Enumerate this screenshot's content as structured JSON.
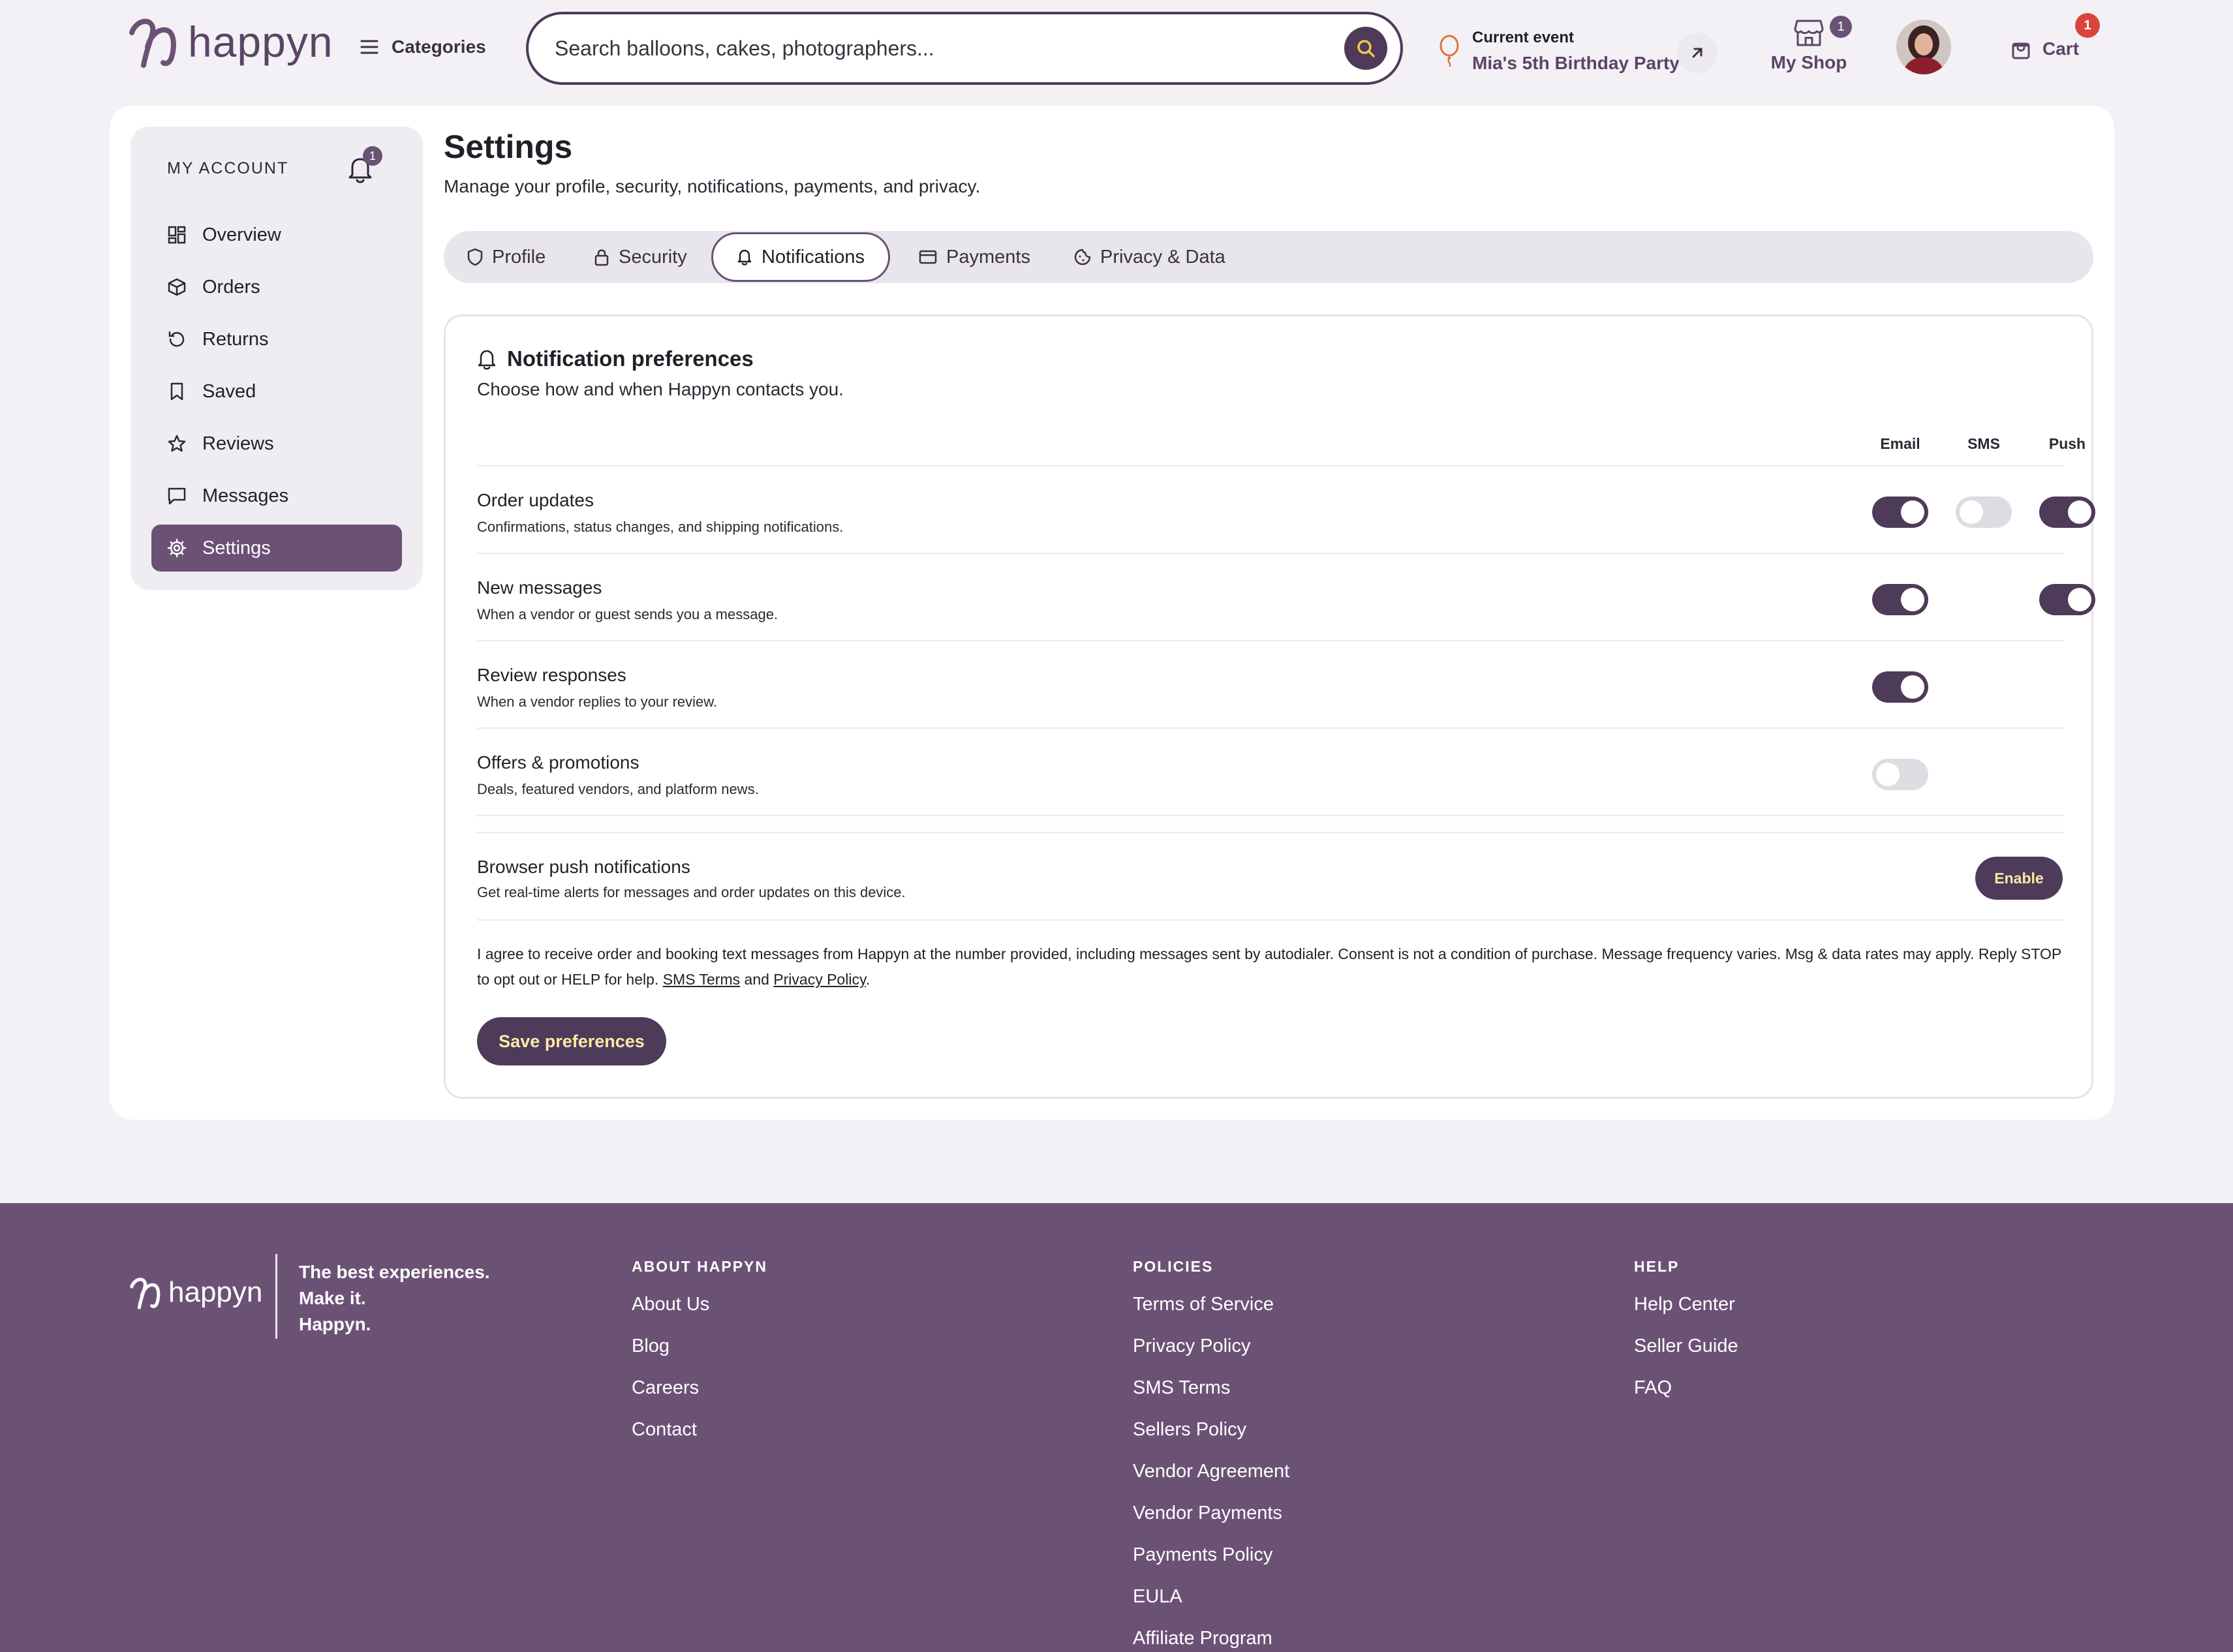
{
  "header": {
    "logo_text": "happyn",
    "categories_label": "Categories",
    "search_placeholder": "Search balloons, cakes, photographers...",
    "event_label": "Current event",
    "event_name": "Mia's 5th Birthday Party",
    "my_shop_label": "My Shop",
    "my_shop_badge": "1",
    "cart_label": "Cart",
    "cart_badge": "1"
  },
  "sidebar": {
    "heading": "MY ACCOUNT",
    "bell_badge": "1",
    "items": [
      {
        "label": "Overview",
        "icon": "grid-icon"
      },
      {
        "label": "Orders",
        "icon": "package-icon"
      },
      {
        "label": "Returns",
        "icon": "return-icon"
      },
      {
        "label": "Saved",
        "icon": "bookmark-icon"
      },
      {
        "label": "Reviews",
        "icon": "star-icon"
      },
      {
        "label": "Messages",
        "icon": "chat-icon"
      },
      {
        "label": "Settings",
        "icon": "gear-icon",
        "active": true
      }
    ]
  },
  "page": {
    "title": "Settings",
    "subtitle": "Manage your profile, security, notifications, payments, and privacy."
  },
  "tabs": [
    {
      "label": "Profile",
      "icon": "shield-icon"
    },
    {
      "label": "Security",
      "icon": "lock-icon"
    },
    {
      "label": "Notifications",
      "icon": "bell-icon",
      "active": true
    },
    {
      "label": "Payments",
      "icon": "card-icon"
    },
    {
      "label": "Privacy & Data",
      "icon": "cookie-icon"
    }
  ],
  "notifications": {
    "title": "Notification preferences",
    "subtitle": "Choose how and when Happyn contacts you.",
    "columns": [
      "Email",
      "SMS",
      "Push"
    ],
    "rows": [
      {
        "title": "Order updates",
        "desc": "Confirmations, status changes, and shipping notifications.",
        "email": true,
        "sms": false,
        "push": true
      },
      {
        "title": "New messages",
        "desc": "When a vendor or guest sends you a message.",
        "email": true,
        "sms": null,
        "push": true
      },
      {
        "title": "Review responses",
        "desc": "When a vendor replies to your review.",
        "email": true,
        "sms": null,
        "push": null
      },
      {
        "title": "Offers & promotions",
        "desc": "Deals, featured vendors, and platform news.",
        "email": false,
        "sms": null,
        "push": null
      }
    ],
    "browser_push": {
      "title": "Browser push notifications",
      "desc": "Get real-time alerts for messages and order updates on this device.",
      "button": "Enable"
    },
    "consent_text": "I agree to receive order and booking text messages from Happyn at the number provided, including messages sent by autodialer. Consent is not a condition of purchase. Message frequency varies. Msg & data rates may apply. Reply STOP to opt out or HELP for help.",
    "sms_terms_link": "SMS Terms",
    "and_text": "and",
    "privacy_link": "Privacy Policy",
    "save_button": "Save preferences"
  },
  "colors": {
    "brand": "#4e3a59",
    "brand_light": "#6b5275",
    "accent_text": "#fde9a6",
    "badge_red": "#d9453c",
    "pin_orange": "#e0733a"
  },
  "footer": {
    "logo_text": "happyn",
    "tagline": [
      "The best experiences.",
      "Make it.",
      "Happyn."
    ],
    "columns": [
      {
        "heading": "ABOUT HAPPYN",
        "links": [
          "About Us",
          "Blog",
          "Careers",
          "Contact"
        ]
      },
      {
        "heading": "POLICIES",
        "links": [
          "Terms of Service",
          "Privacy Policy",
          "SMS Terms",
          "Sellers Policy",
          "Vendor Agreement",
          "Vendor Payments",
          "Payments Policy",
          "EULA",
          "Affiliate Program"
        ]
      },
      {
        "heading": "HELP",
        "links": [
          "Help Center",
          "Seller Guide",
          "FAQ"
        ]
      }
    ]
  }
}
